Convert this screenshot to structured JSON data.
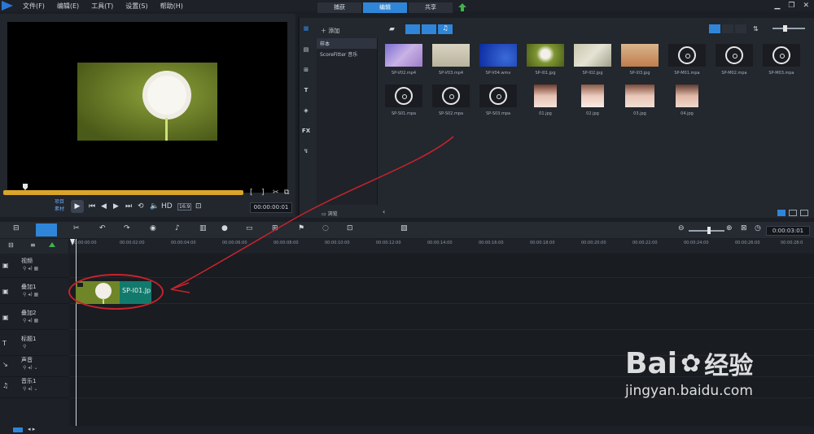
{
  "menu": {
    "items": [
      "文件(F)",
      "编辑(E)",
      "工具(T)",
      "设置(S)",
      "帮助(H)"
    ]
  },
  "tabs": {
    "capture": "捕获",
    "edit": "编辑",
    "share": "共享"
  },
  "preview": {
    "mode_project": "项目",
    "mode_clip": "素材",
    "hd": "HD",
    "timecode": "00:00:00:01"
  },
  "library": {
    "add_label": "添加",
    "folders": [
      "样本",
      "ScoreFitter 音乐"
    ],
    "browse_label": "浏览",
    "media": [
      {
        "name": "SP-V02.mp4",
        "kind": "video"
      },
      {
        "name": "SP-V03.mp4",
        "kind": "video"
      },
      {
        "name": "SP-V04.wmv",
        "kind": "video"
      },
      {
        "name": "SP-I01.jpg",
        "kind": "image"
      },
      {
        "name": "SP-I02.jpg",
        "kind": "image"
      },
      {
        "name": "SP-I03.jpg",
        "kind": "image"
      },
      {
        "name": "SP-M01.mpa",
        "kind": "audio"
      },
      {
        "name": "SP-M02.mpa",
        "kind": "audio"
      },
      {
        "name": "SP-M03.mpa",
        "kind": "audio"
      },
      {
        "name": "SP-S01.mpa",
        "kind": "audio"
      },
      {
        "name": "SP-S02.mpa",
        "kind": "audio"
      },
      {
        "name": "SP-S03.mpa",
        "kind": "audio"
      },
      {
        "name": "01.jpg",
        "kind": "photo"
      },
      {
        "name": "02.jpg",
        "kind": "photo"
      },
      {
        "name": "03.jpg",
        "kind": "photo"
      },
      {
        "name": "04.jpg",
        "kind": "photo"
      }
    ]
  },
  "timeline": {
    "timecode": "0:00:03:01",
    "ruler": [
      "00:00:00:00",
      "00:00:02:00",
      "00:00:04:00",
      "00:00:06:00",
      "00:00:08:00",
      "00:00:10:00",
      "00:00:12:00",
      "00:00:14:00",
      "00:00:16:00",
      "00:00:18:00",
      "00:00:20:00",
      "00:00:22:00",
      "00:00:24:00",
      "00:00:26:00",
      "00:00:28:0"
    ],
    "tracks": [
      "视频",
      "叠加1",
      "叠加2",
      "标题1",
      "声音",
      "音乐1"
    ],
    "clip_label": "SP-I01.Jp"
  },
  "watermark": {
    "brand": "Bai",
    "brand2": "经验",
    "url": "jingyan.baidu.com"
  },
  "colors": {
    "accent": "#2f86d8",
    "clip": "#127a6d",
    "annotation": "#c8232b",
    "scrub": "#d9a62a"
  }
}
